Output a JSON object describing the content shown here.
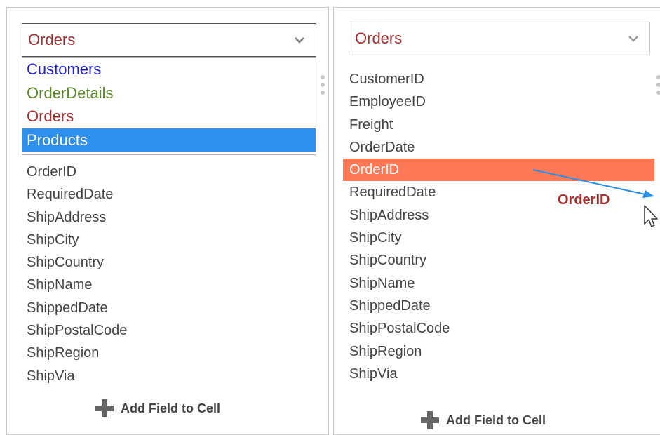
{
  "colors": {
    "customers": "#2222cc",
    "orderdetails": "#5a8a2a",
    "orders": "#a03030",
    "selected_bg": "#2f8fec",
    "highlight_bg": "#ff7957",
    "arrow": "#2b8fe6"
  },
  "left_panel": {
    "dropdown": {
      "value": "Orders",
      "icon": "chevron-down-icon"
    },
    "options": [
      {
        "label": "Customers"
      },
      {
        "label": "OrderDetails"
      },
      {
        "label": "Orders"
      },
      {
        "label": "Products",
        "selected": true
      }
    ],
    "fields": [
      "OrderID",
      "RequiredDate",
      "ShipAddress",
      "ShipCity",
      "ShipCountry",
      "ShipName",
      "ShippedDate",
      "ShipPostalCode",
      "ShipRegion",
      "ShipVia"
    ],
    "add_field": {
      "label": "Add Field to Cell",
      "icon": "plus-icon"
    }
  },
  "right_panel": {
    "dropdown": {
      "value": "Orders",
      "icon": "chevron-down-icon"
    },
    "fields": [
      "CustomerID",
      "EmployeeID",
      "Freight",
      "OrderDate",
      "OrderID",
      "RequiredDate",
      "ShipAddress",
      "ShipCity",
      "ShipCountry",
      "ShipName",
      "ShippedDate",
      "ShipPostalCode",
      "ShipRegion",
      "ShipVia"
    ],
    "highlighted_field": "OrderID",
    "drag": {
      "label": "OrderID",
      "icon": "arrow-pointer-icon"
    },
    "add_field": {
      "label": "Add Field to Cell",
      "icon": "plus-icon"
    }
  }
}
